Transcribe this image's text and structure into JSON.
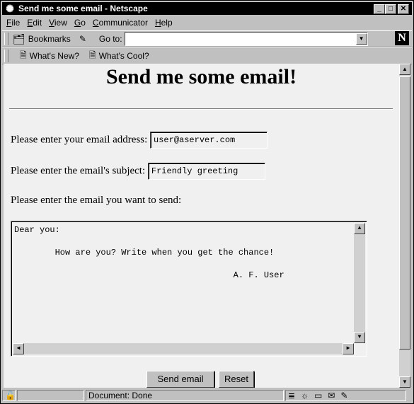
{
  "window": {
    "title": "Send me some email - Netscape"
  },
  "menu": [
    {
      "label": "File",
      "key": "F",
      "rest": "ile"
    },
    {
      "label": "Edit",
      "key": "E",
      "rest": "dit"
    },
    {
      "label": "View",
      "key": "V",
      "rest": "iew"
    },
    {
      "label": "Go",
      "key": "G",
      "rest": "o"
    },
    {
      "label": "Communicator",
      "key": "C",
      "rest": "ommunicator"
    },
    {
      "label": "Help",
      "key": "H",
      "rest": "elp"
    }
  ],
  "toolbar": {
    "bookmarks_label": "Bookmarks",
    "goto_label": "Go to:",
    "location_value": ""
  },
  "personal": {
    "whats_new": "What's New?",
    "whats_cool": "What's Cool?"
  },
  "page": {
    "heading": "Send me some email!",
    "email_label": "Please enter your email address:",
    "email_value": "user@aserver.com",
    "subject_label": "Please enter the email's subject:",
    "subject_value": "Friendly greeting",
    "body_label": "Please enter the email you want to send:",
    "body_value": "Dear you:\n\n        How are you? Write when you get the chance!\n\n                                           A. F. User",
    "send_label": "Send email",
    "reset_label": "Reset"
  },
  "status": {
    "text": "Document: Done"
  },
  "icons": {
    "app": "netscape-icon",
    "logo": "netscape-n-logo"
  }
}
